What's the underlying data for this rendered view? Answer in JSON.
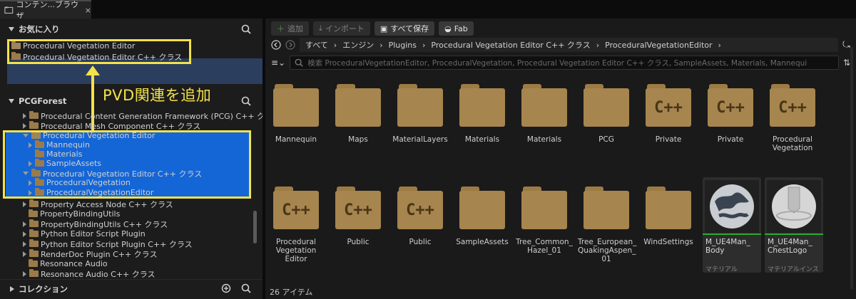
{
  "window": {
    "tab_title": "コンテン...ブラウザ",
    "tab_close": "×"
  },
  "favorites": {
    "header": "お気に入り",
    "items": [
      "Procedural Vegetation Editor",
      "Procedural Vegetation Editor C++ クラス"
    ]
  },
  "annotation": {
    "label": "PVD関連を追加"
  },
  "project": {
    "header": "PCGForest",
    "tree": [
      "Procedural Content Generation Framework (PCG) C++ クラ",
      "Procedural Mesh Component C++ クラス",
      "Procedural Vegetation Editor",
      "Mannequin",
      "Materials",
      "SampleAssets",
      "Procedural Vegetation Editor C++ クラス",
      "ProceduralVegetation",
      "ProceduralVegetationEditor",
      "Property Access Node C++ クラス",
      "PropertyBindingUtils",
      "PropertyBindingUtils C++ クラス",
      "Python Editor Script Plugin",
      "Python Editor Script Plugin C++ クラス",
      "RenderDoc Plugin C++ クラス",
      "Resonance Audio",
      "Resonance Audio C++ クラス"
    ]
  },
  "collections": {
    "header": "コレクション"
  },
  "toolbar": {
    "add": "追加",
    "import": "インポート",
    "save_all": "すべて保存",
    "fab": "Fab"
  },
  "breadcrumb": [
    "すべて",
    "エンジン",
    "Plugins",
    "Procedural Vegetation Editor C++ クラス",
    "ProceduralVegetationEditor"
  ],
  "search": {
    "placeholder": "検索 ProceduralVegetationEditor, ProceduralVegetation, Procedural Vegetation Editor C++ クラス, SampleAssets, Materials, Mannequi"
  },
  "assets": {
    "row1": [
      {
        "name": "Mannequin",
        "cpp": false
      },
      {
        "name": "Maps",
        "cpp": false
      },
      {
        "name": "MaterialLayers",
        "cpp": false
      },
      {
        "name": "Materials",
        "cpp": false
      },
      {
        "name": "Materials",
        "cpp": false
      },
      {
        "name": "PCG",
        "cpp": false
      },
      {
        "name": "Private",
        "cpp": true
      },
      {
        "name": "Private",
        "cpp": true
      },
      {
        "name": "Procedural Vegetation",
        "cpp": true
      }
    ],
    "row2": [
      {
        "name": "Procedural Vegetation Editor",
        "cpp": true
      },
      {
        "name": "Public",
        "cpp": true
      },
      {
        "name": "Public",
        "cpp": true
      },
      {
        "name": "SampleAssets",
        "cpp": false
      },
      {
        "name": "Tree_Common_ Hazel_01",
        "cpp": false
      },
      {
        "name": "Tree_European_ QuakingAspen_ 01",
        "cpp": false
      },
      {
        "name": "WindSettings",
        "cpp": false
      }
    ],
    "materials": [
      {
        "name": "M_UE4Man_ Body",
        "type": "マテリアル"
      },
      {
        "name": "M_UE4Man_ ChestLogo",
        "type": "マテリアルインスタ..."
      }
    ],
    "cpp_label": "C++"
  },
  "status": {
    "count": "26 アイテム"
  }
}
